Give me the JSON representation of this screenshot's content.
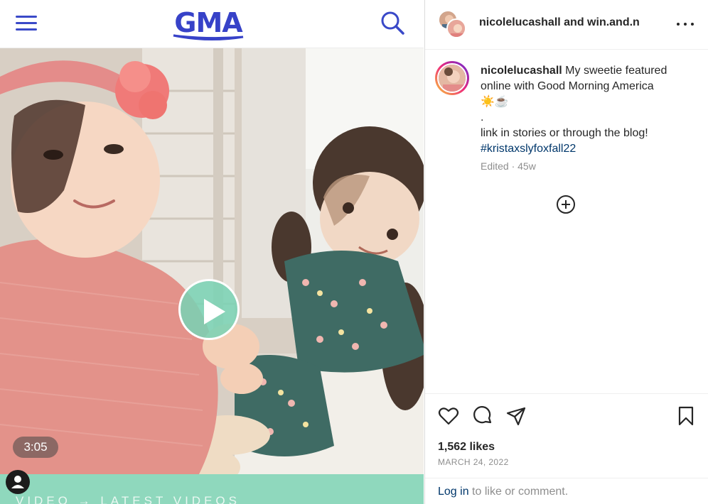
{
  "gma": {
    "logo_text": "GMA",
    "video_duration": "3:05",
    "breadcrumb_text": "VIDEO → LATEST VIDEOS",
    "accent_color": "#3742c8",
    "bar_color": "#8fd8bd"
  },
  "post": {
    "header_names": "nicolelucashall and win.and.n",
    "caption_user": "nicolelucashall",
    "caption_line1": "My sweetie featured online with Good Morning America",
    "caption_emojis": "☀️☕",
    "caption_dot": ".",
    "caption_line3": "link in stories or through the blog!",
    "caption_hashtag": "#kristaxslyfoxfall22",
    "edited_label": "Edited · 45w",
    "likes": "1,562 likes",
    "date": "MARCH 24, 2022",
    "login_link": "Log in",
    "login_suffix": " to like or comment.",
    "link_color": "#00376b"
  },
  "icons": [
    "menu-icon",
    "search-icon",
    "play-icon",
    "user-icon",
    "more-options-icon",
    "add-comment-icon",
    "heart-icon",
    "comment-icon",
    "share-icon",
    "bookmark-icon"
  ]
}
